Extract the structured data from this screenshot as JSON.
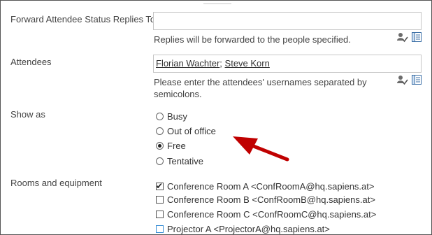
{
  "fields": {
    "forward": {
      "label": "Forward Attendee Status Replies To",
      "value": "",
      "help": "Replies will be forwarded to the people specified."
    },
    "attendees": {
      "label": "Attendees",
      "people": [
        "Florian Wachter",
        "Steve Korn"
      ],
      "separator": ";",
      "help_line1": "Please enter the attendees' usernames separated by",
      "help_line2": "semicolons."
    },
    "show_as": {
      "label": "Show as",
      "options": [
        "Busy",
        "Out of office",
        "Free",
        "Tentative"
      ],
      "selected": "Free"
    },
    "rooms": {
      "label": "Rooms and equipment",
      "items": [
        {
          "text": "Conference Room A <ConfRoomA@hq.sapiens.at>",
          "checked": true
        },
        {
          "text": "Conference Room B <ConfRoomB@hq.sapiens.at>",
          "checked": false
        },
        {
          "text": "Conference Room C <ConfRoomC@hq.sapiens.at>",
          "checked": false
        },
        {
          "text": "Projector A <ProjectorA@hq.sapiens.at>",
          "checked": false
        }
      ]
    }
  },
  "icons": [
    "check-names-icon",
    "address-book-icon"
  ],
  "colors": {
    "annotation_arrow": "#c00000",
    "focus_border": "#3a8fd6"
  }
}
